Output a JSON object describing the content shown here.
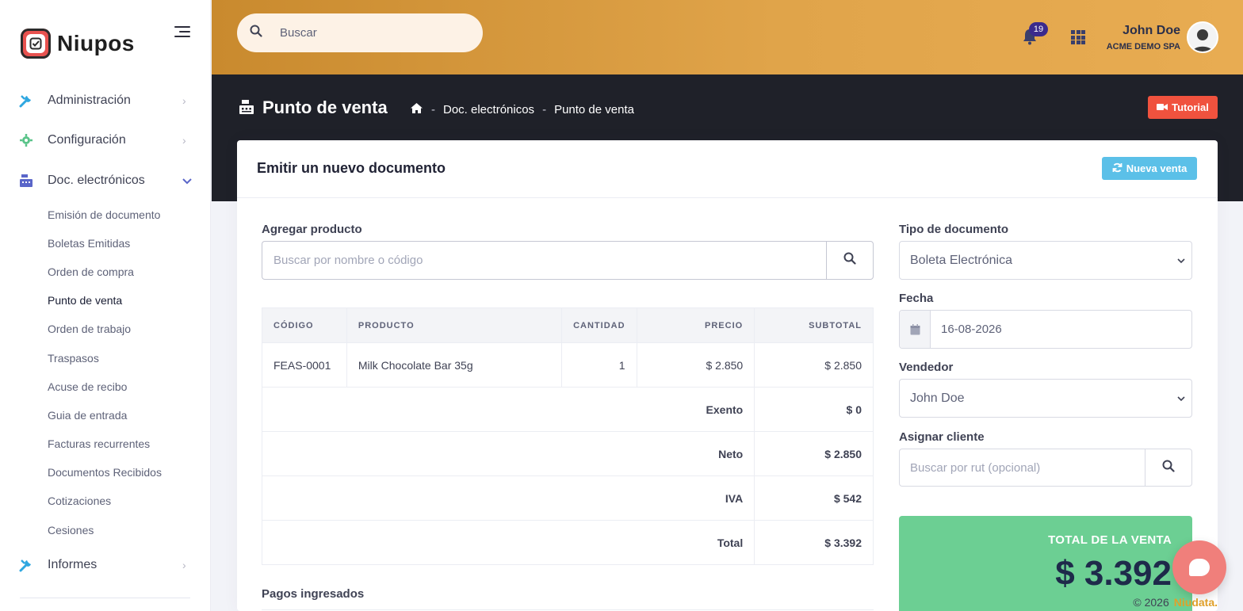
{
  "brand": {
    "name": "Niupos",
    "color": "#e8524f"
  },
  "sidebar": {
    "items": [
      {
        "label": "Administración",
        "icon": "tools-icon",
        "color": "#2fa7e0"
      },
      {
        "label": "Configuración",
        "icon": "gear-icon",
        "color": "#5bc48a"
      },
      {
        "label": "Doc. electrónicos",
        "icon": "cash-register-icon",
        "color": "#5a66c9"
      },
      {
        "label": "Informes",
        "icon": "tools-icon",
        "color": "#2fa7e0"
      }
    ],
    "subitems": [
      "Emisión de documento",
      "Boletas Emitidas",
      "Orden de compra",
      "Punto de venta",
      "Orden de trabajo",
      "Traspasos",
      "Acuse de recibo",
      "Guia de entrada",
      "Facturas recurrentes",
      "Documentos Recibidos",
      "Cotizaciones",
      "Cesiones"
    ],
    "active_subitem": "Punto de venta"
  },
  "topbar": {
    "search_placeholder": "Buscar",
    "notifications_count": "19",
    "user_name": "John Doe",
    "user_company": "ACME DEMO SPA"
  },
  "header": {
    "title": "Punto de venta",
    "breadcrumb": [
      "Doc. electrónicos",
      "Punto de venta"
    ],
    "tutorial_label": "Tutorial"
  },
  "card": {
    "title": "Emitir un nuevo documento",
    "new_sale_label": "Nueva venta",
    "add_product_label": "Agregar producto",
    "product_search_placeholder": "Buscar por nombre o código",
    "table": {
      "headers": [
        "CÓDIGO",
        "PRODUCTO",
        "CANTIDAD",
        "PRECIO",
        "SUBTOTAL"
      ],
      "rows": [
        {
          "code": "FEAS-0001",
          "product": "Milk Chocolate Bar 35g",
          "qty": "1",
          "price": "$ 2.850",
          "subtotal": "$ 2.850"
        }
      ],
      "summary": [
        {
          "label": "Exento",
          "value": "$ 0"
        },
        {
          "label": "Neto",
          "value": "$ 2.850"
        },
        {
          "label": "IVA",
          "value": "$ 542"
        },
        {
          "label": "Total",
          "value": "$ 3.392"
        }
      ]
    },
    "payments_label": "Pagos ingresados",
    "doc_type_label": "Tipo de documento",
    "doc_type_value": "Boleta Electrónica",
    "date_label": "Fecha",
    "date_value": "16-08-2026",
    "seller_label": "Vendedor",
    "seller_value": "John Doe",
    "client_label": "Asignar cliente",
    "client_placeholder": "Buscar por rut (opcional)",
    "total_label": "TOTAL DE LA VENTA",
    "total_value": "$ 3.392"
  },
  "footer": {
    "copyright": "© 2026",
    "company": "Niudata."
  },
  "colors": {
    "topbar": "#e0a44a",
    "header": "#1f2129",
    "tutorial": "#f0523e",
    "new_sale": "#5bc0e8",
    "total": "#6ccf93"
  }
}
